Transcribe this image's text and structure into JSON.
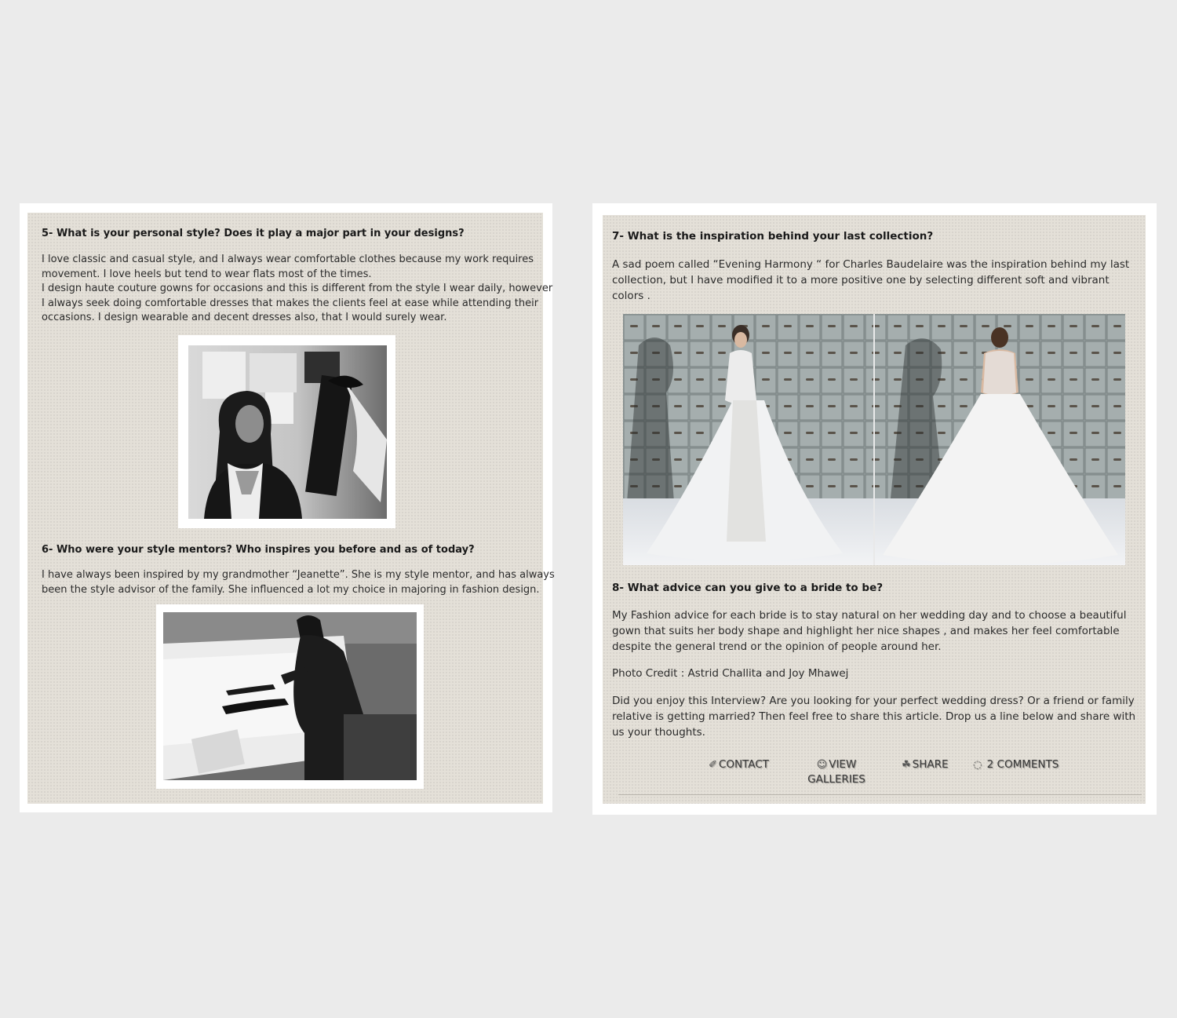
{
  "left_panel": {
    "q5": "5- What is your personal style? Does it play a major part in your designs?",
    "a5_lines": [
      "I love classic and casual style, and I always wear comfortable clothes because my work requires",
      "movement. I love heels but tend to wear flats most of the times.",
      "I design haute couture gowns for occasions and this is different from the style I wear daily, however",
      "I always seek doing comfortable dresses that makes the clients feel at ease while attending their",
      "occasions. I design wearable and decent dresses also, that I would surely wear."
    ],
    "q6": "6- Who were your style mentors? Who inspires you before and as of today?",
    "a6_lines": [
      "I have always been inspired by my grandmother “Jeanette”. She is my style mentor, and has always",
      "been the style advisor of the family. She influenced a lot my choice in majoring in fashion design."
    ]
  },
  "right_panel": {
    "q7": "7- What is the inspiration behind your last collection?",
    "a7_lines": [
      "A sad poem called “Evening Harmony “ for Charles Baudelaire was the inspiration behind my last",
      "collection, but I have modified it to a more positive one by selecting different soft and vibrant",
      "colors ."
    ],
    "q8": "8- What advice can you give to a bride to be?",
    "a8_lines": [
      "My Fashion advice for each bride is to stay natural on her wedding day and to choose a beautiful",
      "gown that suits her body shape and highlight her nice shapes , and makes her feel comfortable",
      "despite the general trend or the opinion of people around her."
    ],
    "credit": "Photo Credit : Astrid Challita and Joy Mhawej",
    "cta_lines": [
      "Did you enjoy this Interview? Are you looking for your perfect wedding dress? Or a friend or family",
      "relative is getting married? Then feel free to share this article. Drop us a line below and share with",
      "us your thoughts."
    ],
    "actions": {
      "contact": "CONTACT",
      "view_galleries_1": "VIEW",
      "view_galleries_2": "GALLERIES",
      "share": "SHARE",
      "comments": "2 COMMENTS"
    }
  },
  "icons": {
    "contact": "link-icon",
    "galleries": "user-plus-icon",
    "share": "share-icon",
    "comments": "comment-icon"
  }
}
